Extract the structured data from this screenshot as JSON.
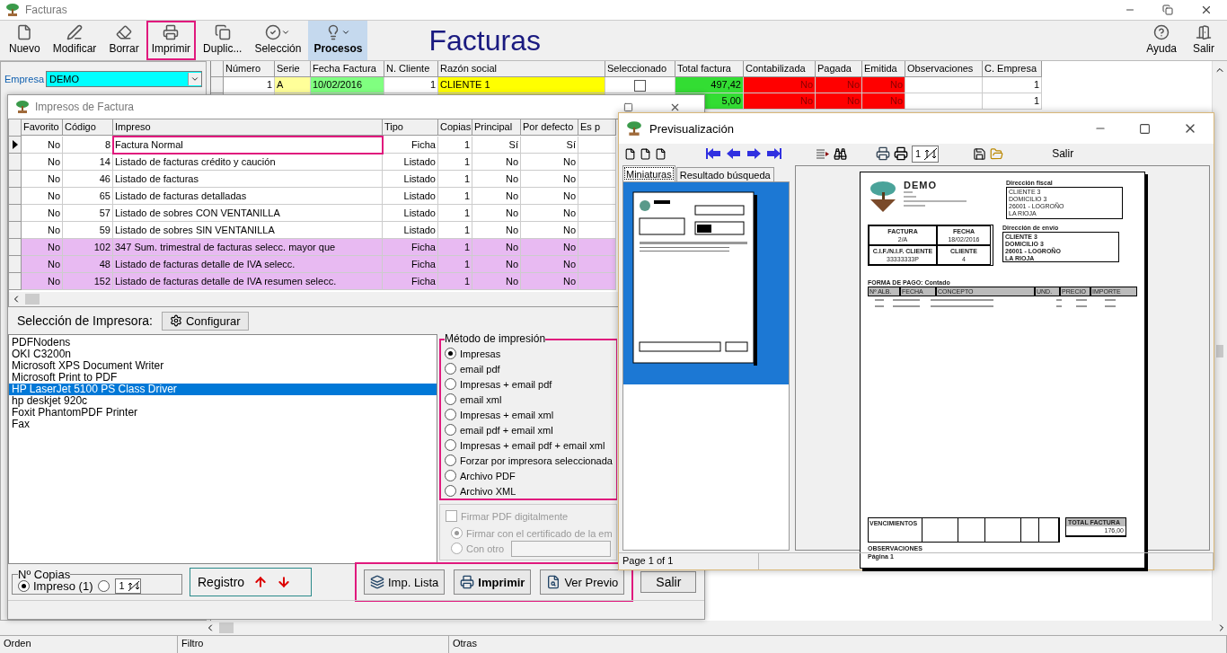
{
  "main_window": {
    "title": "Facturas",
    "heading": "Facturas",
    "toolbar": [
      {
        "kind": "file",
        "label": "Nuevo",
        "selected": false,
        "highlighted": false
      },
      {
        "kind": "edit",
        "label": "Modificar",
        "selected": false,
        "highlighted": false
      },
      {
        "kind": "erase",
        "label": "Borrar",
        "selected": false,
        "highlighted": false
      },
      {
        "kind": "print",
        "label": "Imprimir",
        "selected": false,
        "highlighted": true
      },
      {
        "kind": "duplicate",
        "label": "Duplic...",
        "selected": false,
        "highlighted": false
      },
      {
        "kind": "select",
        "label": "Selección",
        "selected": false,
        "highlighted": false
      },
      {
        "kind": "process",
        "label": "Procesos",
        "selected": true,
        "highlighted": false
      }
    ],
    "right_buttons": [
      {
        "kind": "help",
        "label": "Ayuda"
      },
      {
        "kind": "exit",
        "label": "Salir"
      }
    ],
    "filter": {
      "label": "Empresa",
      "value": "DEMO"
    },
    "grid": {
      "columns": [
        {
          "label": "Número",
          "kind": "number"
        },
        {
          "label": "Serie",
          "kind": "text",
          "color": "#ffff99"
        },
        {
          "label": "Fecha Factura",
          "kind": "text",
          "color": "#80ff80"
        },
        {
          "label": "N. Cliente",
          "kind": "number"
        },
        {
          "label": "Razón social",
          "kind": "text",
          "color": "#ffff00"
        },
        {
          "label": "Seleccionado",
          "kind": "check"
        },
        {
          "label": "Total factura",
          "kind": "number",
          "color": "#33dd33"
        },
        {
          "label": "Contabilizada",
          "kind": "number",
          "color": "#ff0000"
        },
        {
          "label": "Pagada",
          "kind": "number",
          "color": "#ff0000"
        },
        {
          "label": "Emitida",
          "kind": "number",
          "color": "#ff0000"
        },
        {
          "label": "Observaciones",
          "kind": "text"
        },
        {
          "label": "C. Empresa",
          "kind": "number"
        }
      ],
      "rows": [
        {
          "cells": [
            "1",
            "A",
            "10/02/2016",
            "1",
            "CLIENTE 1",
            null,
            "497,42",
            "No",
            "No",
            "No",
            null,
            "1"
          ],
          "seleccionado": false
        },
        {
          "cells": [
            null,
            null,
            null,
            null,
            null,
            null,
            "5,00",
            "No",
            "No",
            "No",
            null,
            "1"
          ]
        }
      ]
    },
    "status_bar": [
      "Orden",
      "Filtro",
      "Otras"
    ]
  },
  "dialog": {
    "title": "Impresos de Factura",
    "columns": [
      "Favorito",
      "Código",
      "Impreso",
      "Tipo",
      "Copias",
      "Principal",
      "Por defecto",
      "Es p"
    ],
    "rows": [
      {
        "cells": [
          "No",
          "8",
          "Factura Normal",
          "Ficha",
          "1",
          "Sí",
          "Sí"
        ],
        "selected": true,
        "highlighted": true,
        "color": "#ffffff"
      },
      {
        "cells": [
          "No",
          "14",
          "Listado de facturas crédito y caución",
          "Listado",
          "1",
          "No",
          "No"
        ],
        "selected": false,
        "highlighted": false,
        "color": "#ffffff"
      },
      {
        "cells": [
          "No",
          "46",
          "Listado de facturas",
          "Listado",
          "1",
          "No",
          "No"
        ],
        "selected": false,
        "highlighted": false,
        "color": "#ffffff"
      },
      {
        "cells": [
          "No",
          "65",
          "Listado de facturas detalladas",
          "Listado",
          "1",
          "No",
          "No"
        ],
        "selected": false,
        "highlighted": false,
        "color": "#ffffff"
      },
      {
        "cells": [
          "No",
          "57",
          "Listado de sobres CON VENTANILLA",
          "Listado",
          "1",
          "No",
          "No"
        ],
        "selected": false,
        "highlighted": false,
        "color": "#ffffff"
      },
      {
        "cells": [
          "No",
          "59",
          "Listado de sobres SIN VENTANILLA",
          "Listado",
          "1",
          "No",
          "No"
        ],
        "selected": false,
        "highlighted": false,
        "color": "#ffffff"
      },
      {
        "cells": [
          "No",
          "102",
          "347 Sum. trimestral de facturas selecc. mayor que",
          "Ficha",
          "1",
          "No",
          "No"
        ],
        "selected": false,
        "highlighted": false,
        "color": "#e8baf2"
      },
      {
        "cells": [
          "No",
          "48",
          "Listado de facturas detalle de IVA selecc.",
          "Ficha",
          "1",
          "No",
          "No"
        ],
        "selected": false,
        "highlighted": false,
        "color": "#e8baf2"
      },
      {
        "cells": [
          "No",
          "152",
          "Listado de facturas detalle de IVA resumen selecc.",
          "Ficha",
          "1",
          "No",
          "No"
        ],
        "selected": false,
        "highlighted": false,
        "color": "#e8baf2"
      }
    ],
    "printer_label": "Selección de Impresora:",
    "configure": "Configurar",
    "printers": [
      {
        "name": "PDFNodens",
        "selected": false
      },
      {
        "name": "OKI C3200n",
        "selected": false
      },
      {
        "name": "Microsoft XPS Document Writer",
        "selected": false
      },
      {
        "name": "Microsoft Print to PDF",
        "selected": false
      },
      {
        "name": "HP LaserJet 5100 PS Class Driver",
        "selected": true
      },
      {
        "name": "hp deskjet 920c",
        "selected": false
      },
      {
        "name": "Foxit PhantomPDF Printer",
        "selected": false
      },
      {
        "name": "Fax",
        "selected": false
      }
    ],
    "method": {
      "title": "Método de impresión",
      "highlighted": true,
      "options": [
        {
          "label": "Impresas",
          "selected": true
        },
        {
          "label": "email pdf",
          "selected": false
        },
        {
          "label": "Impresas + email pdf",
          "selected": false
        },
        {
          "label": "email xml",
          "selected": false
        },
        {
          "label": "Impresas + email xml",
          "selected": false
        },
        {
          "label": "email pdf + email xml",
          "selected": false
        },
        {
          "label": "Impresas + email pdf + email xml",
          "selected": false
        },
        {
          "label": "Forzar por impresora seleccionada",
          "selected": false
        },
        {
          "label": "Archivo PDF",
          "selected": false
        },
        {
          "label": "Archivo XML",
          "selected": false
        }
      ]
    },
    "sign": {
      "label": "Firmar PDF digitalmente",
      "checked": false,
      "disabled": true,
      "options": [
        {
          "label": "Firmar con el certificado de la em",
          "selected": true
        },
        {
          "label": "Con otro",
          "selected": false
        }
      ]
    },
    "copies": {
      "title": "Nº Copias",
      "options": [
        {
          "label": "Impreso (1)",
          "selected": true
        },
        {
          "selected": false
        }
      ],
      "value": "1"
    },
    "registro": {
      "label": "Registro"
    },
    "actions": {
      "highlighted": true,
      "buttons": [
        {
          "kind": "list",
          "label": "Imp. Lista",
          "bold": false
        },
        {
          "kind": "print",
          "label": "Imprimir",
          "bold": true
        },
        {
          "kind": "preview",
          "label": "Ver Previo",
          "bold": false
        }
      ]
    },
    "exit": "Salir"
  },
  "preview": {
    "title": "Previsualización",
    "page_value": "1",
    "exit": "Salir",
    "tabs": [
      {
        "label": "Miniaturas",
        "selected": true
      },
      {
        "label": "Resultado búsqueda",
        "selected": false
      }
    ],
    "status": "Page 1 of 1",
    "document": {
      "company": "DEMO",
      "fiscal_title": "Dirección fiscal",
      "fiscal_lines": [
        "CLIENTE 3",
        "DOMICILIO 3",
        "26001 - LOGROÑO",
        "LA RIOJA"
      ],
      "shipping_title": "Dirección de envío",
      "shipping_lines": [
        "CLIENTE 3",
        "DOMICILIO 3",
        "26001 - LOGROÑO",
        "LA RIOJA"
      ],
      "boxes": [
        {
          "label": "FACTURA",
          "value": "2/A"
        },
        {
          "label": "FECHA",
          "value": "18/02/2016"
        },
        {
          "label": "C.I.F./N.I.F. CLIENTE",
          "value": "33333333P"
        },
        {
          "label": "CLIENTE",
          "value": "4"
        }
      ],
      "payment": "FORMA DE PAGO: Contado",
      "line_headers": [
        "Nº ALB.",
        "FECHA",
        "CONCEPTO",
        "UND.",
        "PRECIO",
        "IMPORTE"
      ],
      "due_title": "VENCIMIENTOS",
      "total_title": "TOTAL FACTURA",
      "total_value": "176,00",
      "notes": "OBSERVACIONES",
      "page": "Página 1"
    }
  }
}
